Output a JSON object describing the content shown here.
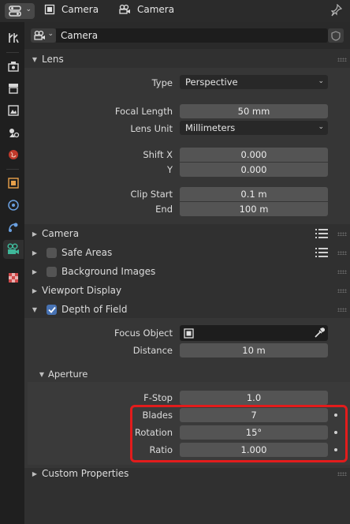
{
  "header": {
    "object_name": "Camera",
    "data_name": "Camera"
  },
  "datablock": {
    "name": "Camera"
  },
  "lens": {
    "title": "Lens",
    "type_label": "Type",
    "type_value": "Perspective",
    "focal_length_label": "Focal Length",
    "focal_length_value": "50 mm",
    "lens_unit_label": "Lens Unit",
    "lens_unit_value": "Millimeters",
    "shift_x_label": "Shift X",
    "shift_x_value": "0.000",
    "shift_y_label": "Y",
    "shift_y_value": "0.000",
    "clip_start_label": "Clip Start",
    "clip_start_value": "0.1 m",
    "clip_end_label": "End",
    "clip_end_value": "100 m"
  },
  "panels": {
    "camera": "Camera",
    "safe_areas": "Safe Areas",
    "background_images": "Background Images",
    "viewport_display": "Viewport Display",
    "depth_of_field": "Depth of Field",
    "custom_properties": "Custom Properties"
  },
  "dof": {
    "focus_object_label": "Focus Object",
    "distance_label": "Distance",
    "distance_value": "10 m",
    "enabled": true
  },
  "aperture": {
    "title": "Aperture",
    "fstop_label": "F-Stop",
    "fstop_value": "1.0",
    "blades_label": "Blades",
    "blades_value": "7",
    "rotation_label": "Rotation",
    "rotation_value": "15°",
    "ratio_label": "Ratio",
    "ratio_value": "1.000"
  },
  "colors": {
    "highlight": "#e21c1c",
    "accent": "#4772b3",
    "camera_tab": "#3fb89a"
  }
}
